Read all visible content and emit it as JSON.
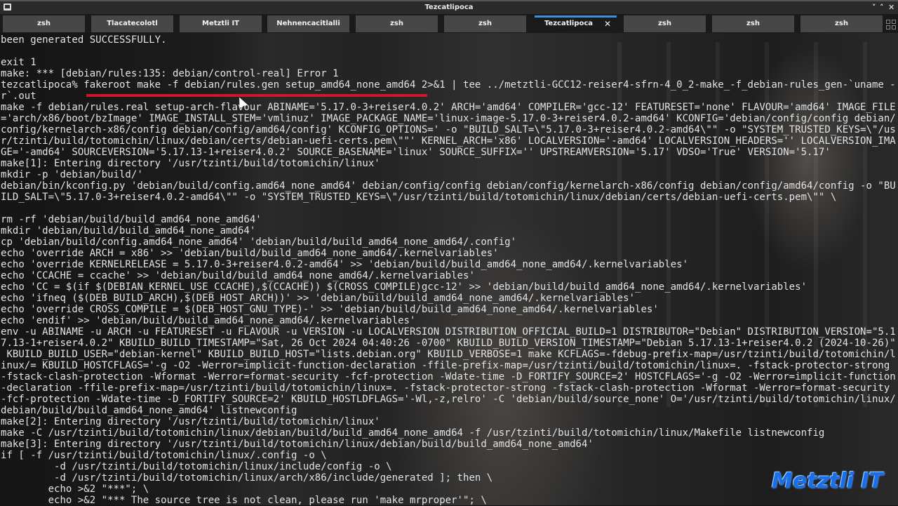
{
  "window": {
    "title": "Tezcatlipoca",
    "controls": [
      "minimize-icon",
      "maximize-icon",
      "close-icon"
    ]
  },
  "tabs": [
    {
      "label": "zsh"
    },
    {
      "label": "Tlacatecolotl"
    },
    {
      "label": "Metztli IT"
    },
    {
      "label": "Nehnencacitlalli"
    },
    {
      "label": "zsh"
    },
    {
      "label": "zsh"
    },
    {
      "label": "Tezcatlipoca",
      "active": true,
      "close": "✕"
    },
    {
      "label": "zsh"
    },
    {
      "label": "zsh"
    },
    {
      "label": "zsh"
    }
  ],
  "accent_color": "#3d8fe0",
  "annotation_color": "#d2142c",
  "terminal": {
    "lines": [
      "been generated SUCCESSFULLY.",
      "",
      "exit 1",
      "make: *** [debian/rules:135: debian/control-real] Error 1",
      "tezcatlipoca% fakeroot make -f debian/rules.gen setup_amd64_none_amd64 2>&1 | tee ../metztli-GCC12-reiser4-sfrn-4_0_2-make_-f_debian-rules_gen-`uname -",
      "r`.out",
      "make -f debian/rules.real setup-arch-flavour ABINAME='5.17.0-3+reiser4.0.2' ARCH='amd64' COMPILER='gcc-12' FEATURESET='none' FLAVOUR='amd64' IMAGE_FILE",
      "='arch/x86/boot/bzImage' IMAGE_INSTALL_STEM='vmlinuz' IMAGE_PACKAGE_NAME='linux-image-5.17.0-3+reiser4.0.2-amd64' KCONFIG='debian/config/config debian/",
      "config/kernelarch-x86/config debian/config/amd64/config' KCONFIG_OPTIONS=' -o \"BUILD_SALT=\\\"5.17.0-3+reiser4.0.2-amd64\\\"\" -o \"SYSTEM_TRUSTED_KEYS=\\\"/us",
      "r/tzinti/build/totomichin/linux/debian/certs/debian-uefi-certs.pem\\\"\"' KERNEL_ARCH='x86' LOCALVERSION='-amd64' LOCALVERSION_HEADERS='' LOCALVERSION_IMA",
      "GE='-amd64' SOURCEVERSION='5.17.13-1+reiser4.0.2' SOURCE_BASENAME='linux' SOURCE_SUFFIX='' UPSTREAMVERSION='5.17' VDSO='True' VERSION='5.17'",
      "make[1]: Entering directory '/usr/tzinti/build/totomichin/linux'",
      "mkdir -p 'debian/build/'",
      "debian/bin/kconfig.py 'debian/build/config.amd64_none_amd64' debian/config/config debian/config/kernelarch-x86/config debian/config/amd64/config -o \"BU",
      "ILD_SALT=\\\"5.17.0-3+reiser4.0.2-amd64\\\"\" -o \"SYSTEM_TRUSTED_KEYS=\\\"/usr/tzinti/build/totomichin/linux/debian/certs/debian-uefi-certs.pem\\\"\" \\",
      "",
      "rm -rf 'debian/build/build_amd64_none_amd64'",
      "mkdir 'debian/build/build_amd64_none_amd64'",
      "cp 'debian/build/config.amd64_none_amd64' 'debian/build/build_amd64_none_amd64/.config'",
      "echo 'override ARCH = x86' >> 'debian/build/build_amd64_none_amd64/.kernelvariables'",
      "echo 'override KERNELRELEASE = 5.17.0-3+reiser4.0.2-amd64' >> 'debian/build/build_amd64_none_amd64/.kernelvariables'",
      "echo 'CCACHE = ccache' >> 'debian/build/build_amd64_none_amd64/.kernelvariables'",
      "echo 'CC = $(if $(DEBIAN_KERNEL_USE_CCACHE),$(CCACHE)) $(CROSS_COMPILE)gcc-12' >> 'debian/build/build_amd64_none_amd64/.kernelvariables'",
      "echo 'ifneq ($(DEB_BUILD_ARCH),$(DEB_HOST_ARCH))' >> 'debian/build/build_amd64_none_amd64/.kernelvariables'",
      "echo 'override CROSS_COMPILE = $(DEB_HOST_GNU_TYPE)-' >> 'debian/build/build_amd64_none_amd64/.kernelvariables'",
      "echo 'endif' >> 'debian/build/build_amd64_none_amd64/.kernelvariables'",
      "env -u ABINAME -u ARCH -u FEATURESET -u FLAVOUR -u VERSION -u LOCALVERSION DISTRIBUTION_OFFICIAL_BUILD=1 DISTRIBUTOR=\"Debian\" DISTRIBUTION_VERSION=\"5.1",
      "7.13-1+reiser4.0.2\" KBUILD_BUILD_TIMESTAMP=\"Sat, 26 Oct 2024 04:40:26 -0700\" KBUILD_BUILD_VERSION_TIMESTAMP=\"Debian 5.17.13-1+reiser4.0.2 (2024-10-26)\"",
      " KBUILD_BUILD_USER=\"debian-kernel\" KBUILD_BUILD_HOST=\"lists.debian.org\" KBUILD_VERBOSE=1 make KCFLAGS=-fdebug-prefix-map=/usr/tzinti/build/totomichin/l",
      "inux/= KBUILD_HOSTCFLAGS='-g -O2 -Werror=implicit-function-declaration -ffile-prefix-map=/usr/tzinti/build/totomichin/linux=. -fstack-protector-strong",
      "-fstack-clash-protection -Wformat -Werror=format-security -fcf-protection -Wdate-time -D_FORTIFY_SOURCE=2' HOSTCFLAGS='-g -O2 -Werror=implicit-function",
      "-declaration -ffile-prefix-map=/usr/tzinti/build/totomichin/linux=. -fstack-protector-strong -fstack-clash-protection -Wformat -Werror=format-security",
      "-fcf-protection -Wdate-time -D_FORTIFY_SOURCE=2' KBUILD_HOSTLDFLAGS='-Wl,-z,relro' -C 'debian/build/source_none' O='/usr/tzinti/build/totomichin/linux/",
      "debian/build/build_amd64_none_amd64' listnewconfig",
      "make[2]: Entering directory '/usr/tzinti/build/totomichin/linux'",
      "make -C /usr/tzinti/build/totomichin/linux/debian/build/build_amd64_none_amd64 -f /usr/tzinti/build/totomichin/linux/Makefile listnewconfig",
      "make[3]: Entering directory '/usr/tzinti/build/totomichin/linux/debian/build/build_amd64_none_amd64'",
      "if [ -f /usr/tzinti/build/totomichin/linux/.config -o \\",
      "         -d /usr/tzinti/build/totomichin/linux/include/config -o \\",
      "         -d /usr/tzinti/build/totomichin/linux/arch/x86/include/generated ]; then \\",
      "        echo >&2 \"***\"; \\",
      "        echo >&2 \"*** The source tree is not clean, please run 'make mrproper'\"; \\"
    ]
  },
  "watermark": {
    "text": "Metztli IT",
    "color": "#1a6fe8"
  }
}
